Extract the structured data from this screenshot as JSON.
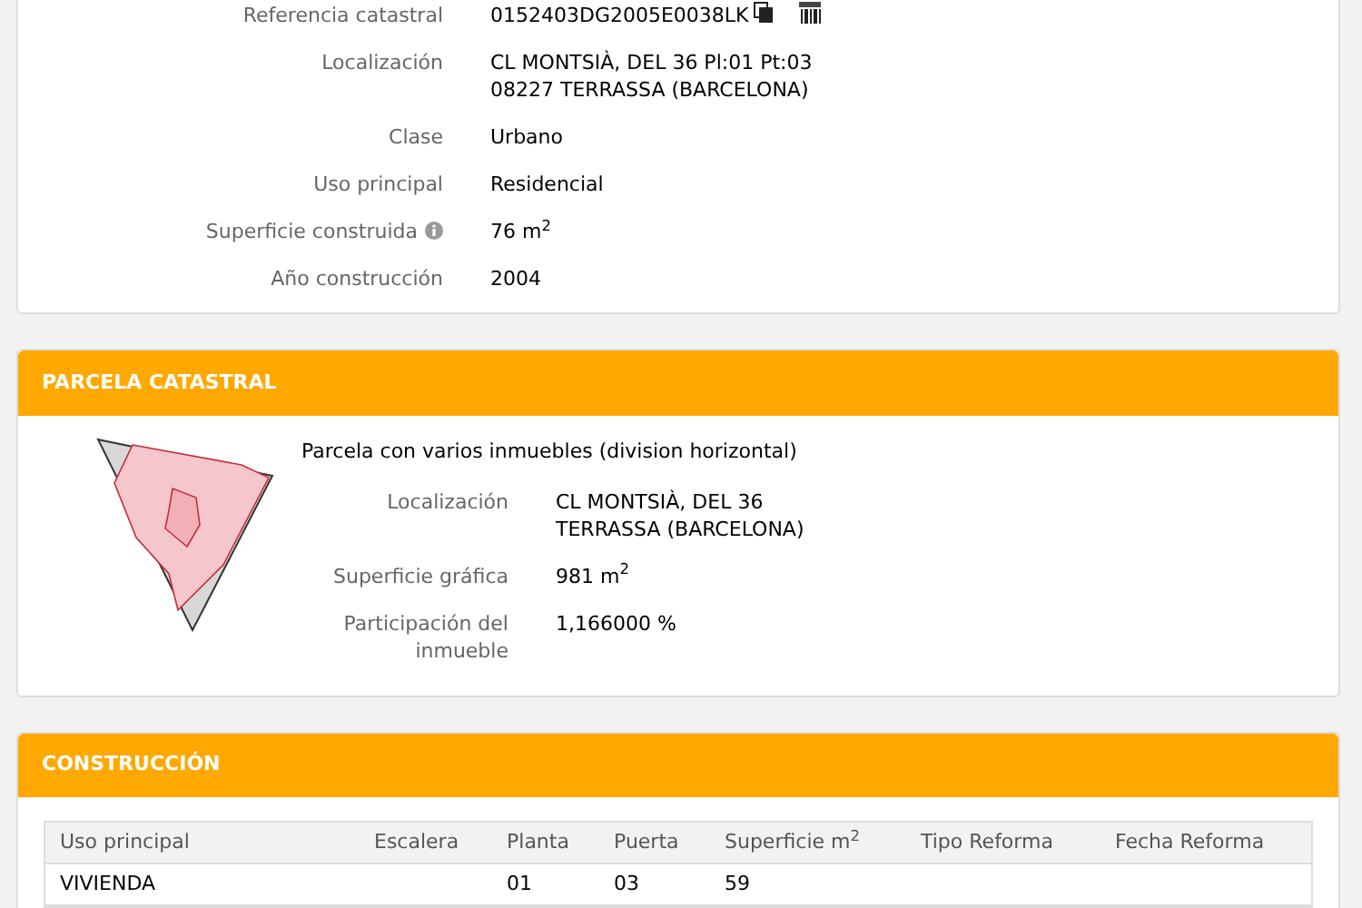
{
  "inmueble": {
    "rows": [
      {
        "label": "Referencia catastral",
        "value": "0152403DG2005E0038LK",
        "icons": true
      },
      {
        "label": "Localización",
        "value": "CL MONTSIÀ, DEL 36 Pl:01 Pt:03\n08227 TERRASSA (BARCELONA)"
      },
      {
        "label": "Clase",
        "value": "Urbano"
      },
      {
        "label": "Uso principal",
        "value": "Residencial"
      },
      {
        "label": "Superficie construida",
        "value": "76 m$^{2}$",
        "info": true
      },
      {
        "label": "Año construcción",
        "value": "2004"
      }
    ]
  },
  "parcela": {
    "title": "PARCELA CATASTRAL",
    "subtitle": "Parcela con varios inmuebles (division horizontal)",
    "rows": [
      {
        "label": "Localización",
        "value": "CL MONTSIÀ, DEL 36\nTERRASSA (BARCELONA)"
      },
      {
        "label": "Superficie gráfica",
        "value": "981 m$^{2}$"
      },
      {
        "label": "Participación del\ninmueble",
        "value": "1,166000 %"
      }
    ]
  },
  "construccion": {
    "title": "CONSTRUCCIÓN",
    "columns": [
      "Uso principal",
      "Escalera",
      "Planta",
      "Puerta",
      "Superficie m$^{2}$",
      "Tipo Reforma",
      "Fecha Reforma"
    ],
    "rows": [
      [
        "VIVIENDA",
        "",
        "01",
        "03",
        "59",
        "",
        ""
      ]
    ]
  }
}
